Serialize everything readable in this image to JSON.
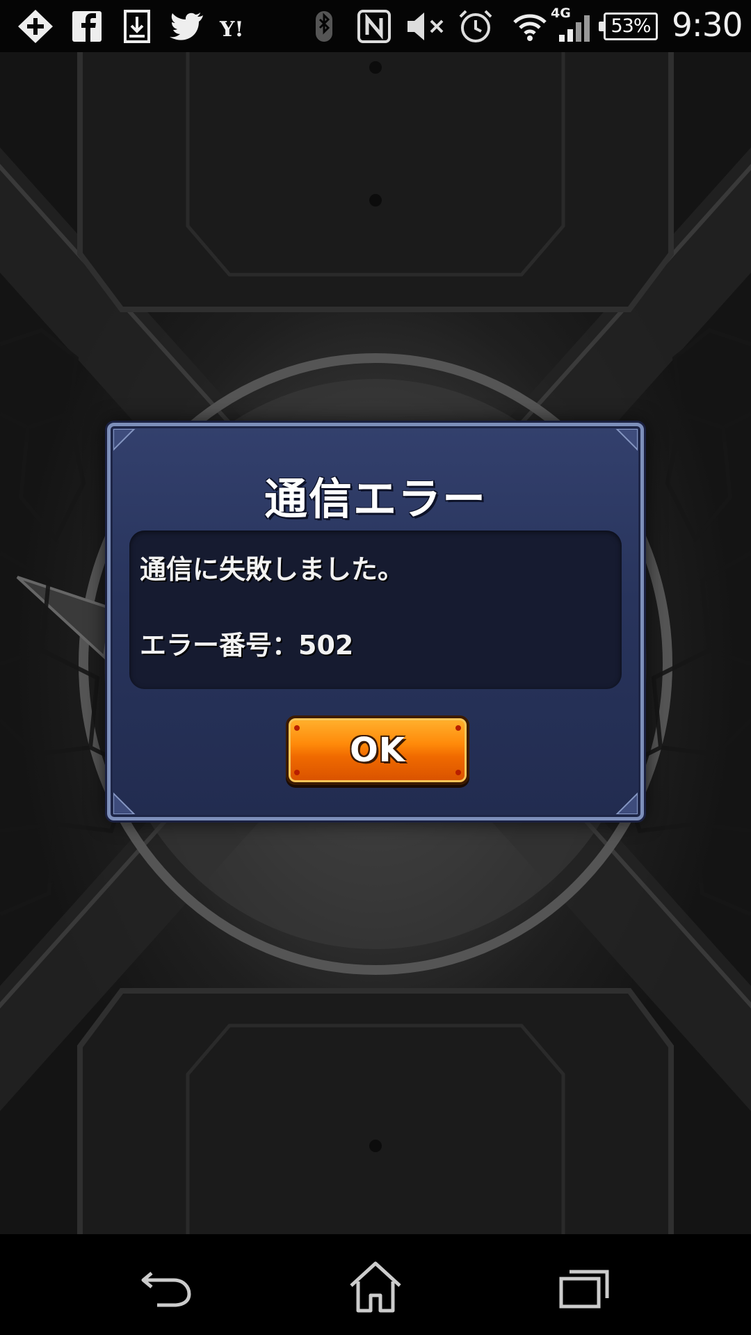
{
  "status_bar": {
    "battery_text": "53%",
    "clock": "9:30",
    "network_label": "4G",
    "left_icons": [
      "add-app-icon",
      "facebook-icon",
      "download-icon",
      "twitter-icon",
      "yahoo-icon"
    ],
    "right_icons": [
      "bluetooth-icon",
      "nfc-icon",
      "mute-icon",
      "alarm-icon",
      "wifi-icon",
      "signal-icon",
      "battery-icon"
    ]
  },
  "dialog": {
    "title": "通信エラー",
    "message": "通信に失敗しました。",
    "error_code": "エラー番号：502",
    "ok_label": "OK",
    "colors": {
      "panel": "#28345c",
      "border": "#7d8fba",
      "message_bg": "#161b30",
      "button": "#ff8a0a"
    }
  },
  "navigation": {
    "buttons": [
      "back-icon",
      "home-icon",
      "recent-apps-icon"
    ]
  }
}
